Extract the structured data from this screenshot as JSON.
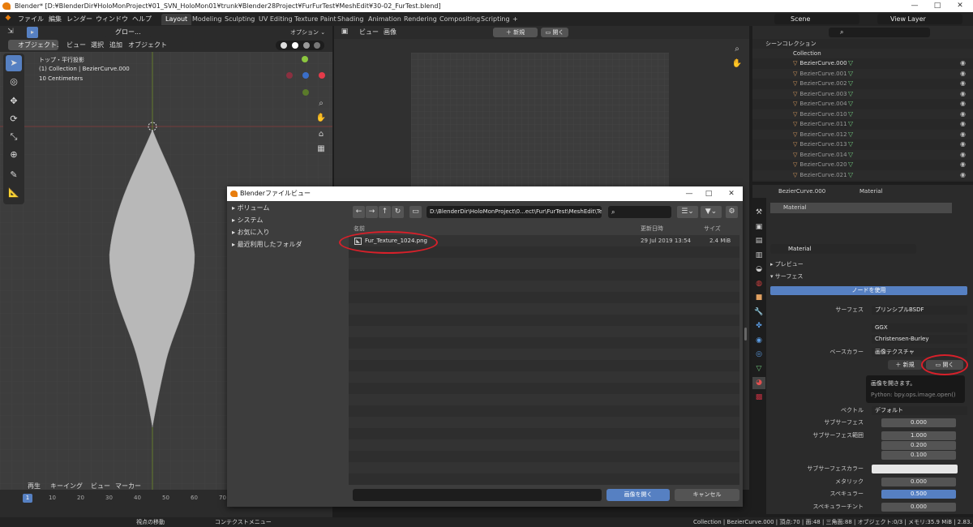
{
  "window": {
    "title": "Blender* [D:¥BlenderDir¥HoloMonProject¥01_SVN_HoloMon01¥trunk¥Blender28Project¥FurFurTest¥MeshEdit¥30-02_FurTest.blend]",
    "min": "—",
    "max": "□",
    "close": "✕"
  },
  "menubar": {
    "items": [
      "ファイル",
      "編集",
      "レンダー",
      "ウィンドウ",
      "ヘルプ"
    ],
    "workspaces": [
      "Layout",
      "Modeling",
      "Sculpting",
      "UV Editing",
      "Texture Paint",
      "Shading",
      "Animation",
      "Rendering",
      "Compositing",
      "Scripting",
      "+"
    ],
    "scene": "Scene",
    "view_layer": "View Layer"
  },
  "viewport": {
    "mode": "オブジェクト...",
    "transform": "グロー...",
    "menu": [
      "ビュー",
      "選択",
      "追加",
      "オブジェクト"
    ],
    "options": "オプション",
    "overlay_title": "トップ・平行投影",
    "overlay_obj": "(1) Collection | BezierCurve.000",
    "overlay_scale": "10 Centimeters"
  },
  "image_editor": {
    "menu": [
      "ビュー",
      "画像"
    ],
    "new": "新規",
    "open": "開く"
  },
  "outliner": {
    "title": "シーンコレクション",
    "collection": "Collection",
    "items": [
      "BezierCurve.000",
      "BezierCurve.001",
      "BezierCurve.002",
      "BezierCurve.003",
      "BezierCurve.004",
      "BezierCurve.010",
      "BezierCurve.011",
      "BezierCurve.012",
      "BezierCurve.013",
      "BezierCurve.014",
      "BezierCurve.020",
      "BezierCurve.021"
    ]
  },
  "properties": {
    "breadcrumb_obj": "BezierCurve.000",
    "breadcrumb_mat": "Material",
    "slot": "Material",
    "material_name": "Material",
    "preview": "プレビュー",
    "surface_panel": "サーフェス",
    "use_nodes": "ノードを使用",
    "rows": [
      {
        "label": "サーフェス",
        "value": "プリンシプルBSDF",
        "kind": "drop"
      },
      {
        "label": "",
        "value": "GGX",
        "kind": "drop"
      },
      {
        "label": "",
        "value": "Christensen-Burley",
        "kind": "drop"
      },
      {
        "label": "ベースカラー",
        "value": "画像テクスチャ",
        "kind": "drop"
      }
    ],
    "tex_new": "新規",
    "tex_open": "開く",
    "tooltip_title": "画像を開きます。",
    "tooltip_python": "Python: bpy.ops.image.open()",
    "rows2": [
      {
        "label": "ベクトル",
        "value": "デフォルト",
        "kind": "drop"
      },
      {
        "label": "サブサーフェス",
        "value": "0.000",
        "kind": "num"
      },
      {
        "label": "サブサーフェス範囲",
        "value": "1.000",
        "kind": "num"
      },
      {
        "label": "",
        "value": "0.200",
        "kind": "num"
      },
      {
        "label": "",
        "value": "0.100",
        "kind": "num"
      },
      {
        "label": "サブサーフェスカラー",
        "value": "",
        "kind": "color"
      },
      {
        "label": "メタリック",
        "value": "0.000",
        "kind": "num"
      },
      {
        "label": "スペキュラー",
        "value": "0.500",
        "kind": "num"
      },
      {
        "label": "スペキュラーチント",
        "value": "0.000",
        "kind": "num"
      }
    ]
  },
  "timeline": {
    "menu": [
      "再生",
      "キーイング",
      "ビュー",
      "マーカー"
    ],
    "current": "1",
    "ticks": [
      "10",
      "20",
      "30",
      "40",
      "50",
      "60",
      "70"
    ]
  },
  "statusbar": {
    "left": "視点の移動",
    "mid": "コンテクストメニュー",
    "right": "Collection | BezierCurve.000 | 頂点:70 | 面:48 | 三角面:88 | オブジェクト:0/3 | メモリ:35.9 MiB | 2.83.0"
  },
  "filebrowser": {
    "title": "Blenderファイルビュー",
    "sidebar": [
      "ボリューム",
      "システム",
      "お気に入り",
      "最近利用したフォルダ"
    ],
    "path": "D:\\BlenderDir\\HoloMonProject\\0...ect\\Fur\\FurTest\\MeshEdit\\Texture\\",
    "search_placeholder": "",
    "columns": {
      "name": "名前",
      "date": "更新日時",
      "size": "サイズ"
    },
    "files": [
      {
        "name": "Fur_Texture_1024.png",
        "date": "29 Jul 2019 13:54",
        "size": "2.4 MiB"
      }
    ],
    "filename": "",
    "open_button": "画像を開く",
    "cancel_button": "キャンセル"
  },
  "colors": {
    "accent": "#5680c2",
    "highlight_red": "#d8202a",
    "blender_orange": "#e87d0d"
  }
}
